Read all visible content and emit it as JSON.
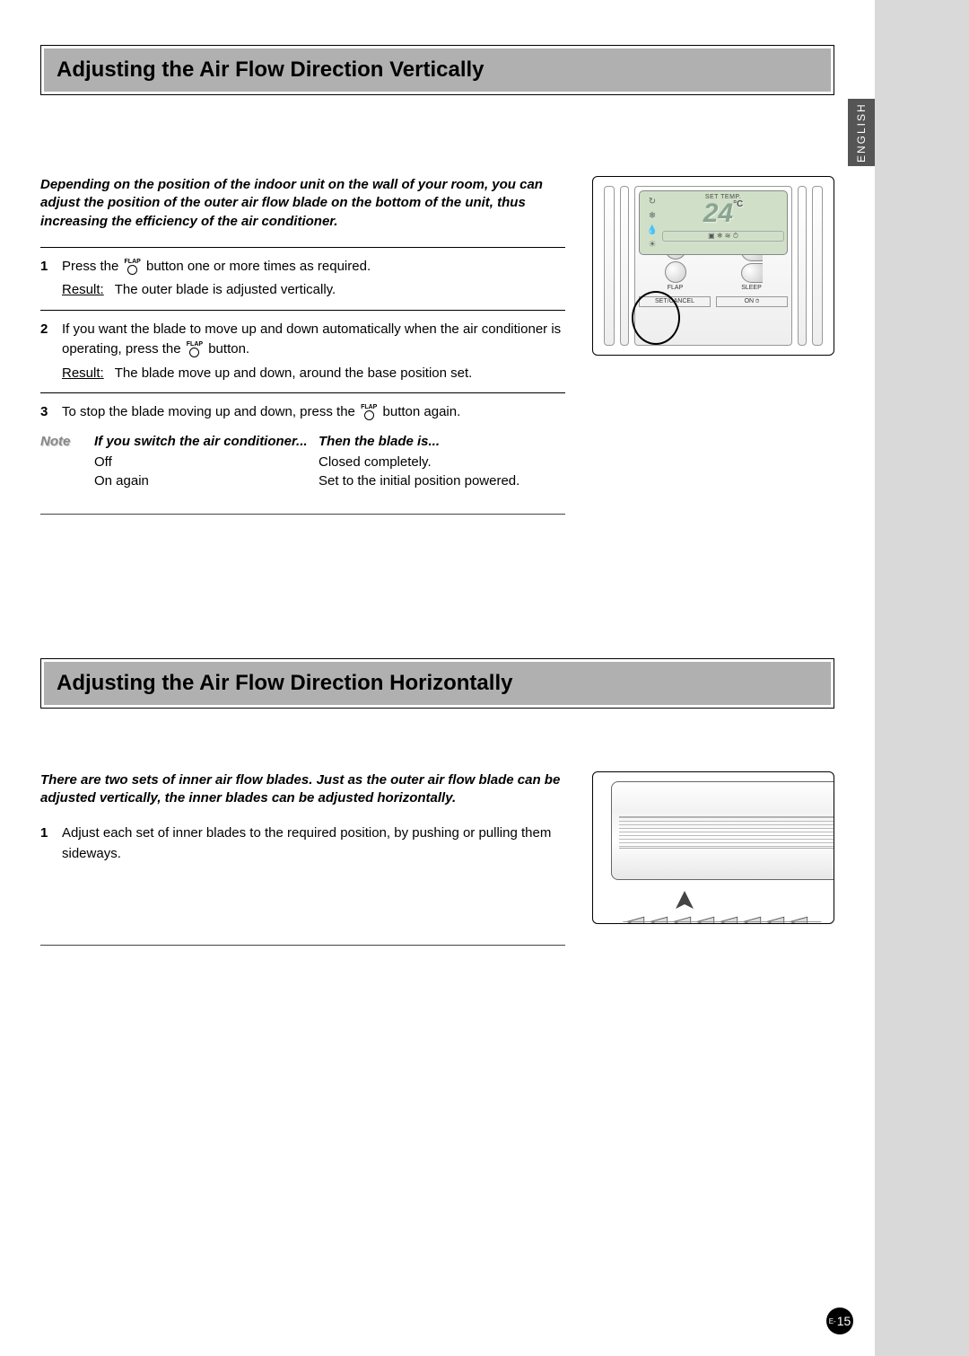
{
  "language_tab": "ENGLISH",
  "section1": {
    "title": "Adjusting the Air Flow Direction Vertically",
    "intro": "Depending on the position of the indoor unit on the wall of your room, you can adjust the position of the outer air flow blade on the bottom of the unit, thus increasing the efficiency of the air conditioner.",
    "steps": [
      {
        "num": "1",
        "text_pre": "Press the ",
        "text_post": " button one or more times as required.",
        "result_label": "Result",
        "result_text": "The outer blade is adjusted vertically."
      },
      {
        "num": "2",
        "text_pre": "If you want the blade to move up and down automatically when the air conditioner is operating, press the ",
        "text_post": " button.",
        "result_label": "Result",
        "result_text": "The blade move up and down, around the base position set."
      },
      {
        "num": "3",
        "text_pre": "To stop the blade moving up and down, press the ",
        "text_post": " button again."
      }
    ],
    "note": {
      "label": "Note",
      "header_col1": "If you switch the air conditioner...",
      "header_col2": "Then the blade is...",
      "rows": [
        {
          "c1": "Off",
          "c2": "Closed completely."
        },
        {
          "c1": "On again",
          "c2": "Set to the initial position powered."
        }
      ]
    },
    "flap_label": "FLAP",
    "remote": {
      "lcd_set_temp": "SET TEMP.",
      "lcd_temp": "24",
      "lcd_unit": "°C",
      "btn_flap": "FLAP",
      "btn_sleep": "SLEEP",
      "btn_setcancel": "SET/CANCEL",
      "btn_on": "ON"
    }
  },
  "section2": {
    "title": "Adjusting the Air Flow Direction Horizontally",
    "intro": "There are two sets of inner air flow blades. Just as the outer air flow blade can be adjusted vertically, the inner blades can be adjusted horizontally.",
    "steps": [
      {
        "num": "1",
        "text": "Adjust each set of inner blades to the required position, by pushing or pulling them sideways."
      }
    ]
  },
  "page_number_prefix": "E-",
  "page_number": "15"
}
